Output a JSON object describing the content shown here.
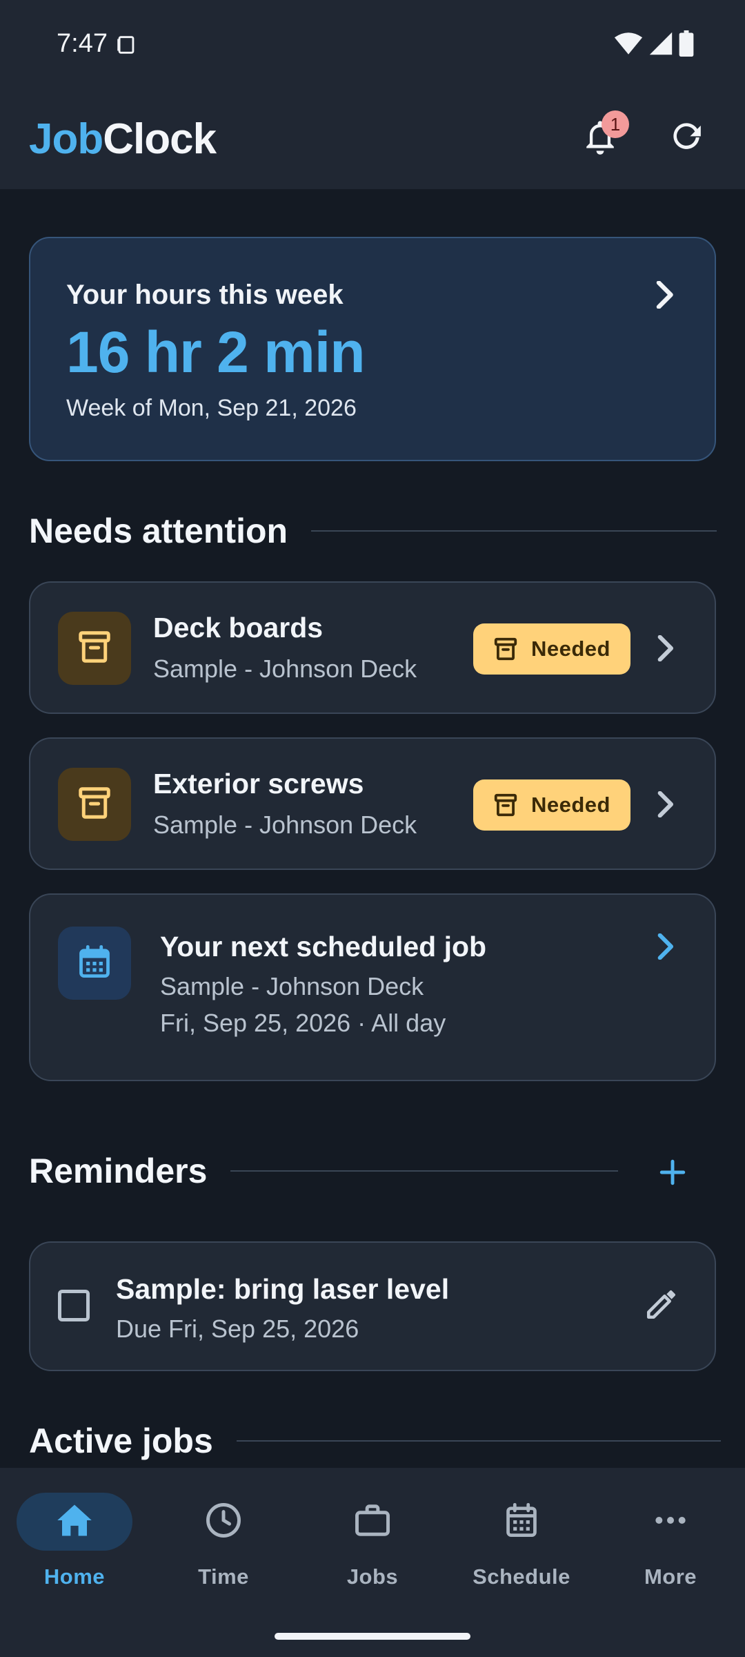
{
  "status_bar": {
    "time": "7:47",
    "icons": [
      "sim-card-icon",
      "wifi-icon",
      "signal-icon",
      "battery-icon"
    ]
  },
  "app_bar": {
    "title_part1": "Job",
    "title_part2": "Clock",
    "notification_count": "1",
    "icons": [
      "bell-icon",
      "refresh-icon"
    ]
  },
  "hours_card": {
    "label": "Your hours this week",
    "value": "16 hr 2 min",
    "week": "Week of Mon, Sep 21, 2026"
  },
  "needs_attention": {
    "title": "Needs attention",
    "items": [
      {
        "title": "Deck boards",
        "subtitle": "Sample - Johnson Deck",
        "status": "Needed",
        "icon": "archive-box-icon"
      },
      {
        "title": "Exterior screws",
        "subtitle": "Sample - Johnson Deck",
        "status": "Needed",
        "icon": "archive-box-icon"
      }
    ],
    "next_job": {
      "title": "Your next scheduled job",
      "subtitle": "Sample - Johnson Deck",
      "date": "Fri, Sep 25, 2026 · All day",
      "icon": "calendar-icon"
    }
  },
  "reminders": {
    "title": "Reminders",
    "add_icon": "plus-icon",
    "items": [
      {
        "title": "Sample: bring laser level",
        "due": "Due Fri, Sep 25, 2026",
        "checked": false
      }
    ]
  },
  "active_jobs": {
    "title": "Active jobs"
  },
  "bottom_nav": {
    "items": [
      {
        "label": "Home",
        "icon": "home-icon",
        "active": true
      },
      {
        "label": "Time",
        "icon": "clock-icon",
        "active": false
      },
      {
        "label": "Jobs",
        "icon": "briefcase-icon",
        "active": false
      },
      {
        "label": "Schedule",
        "icon": "calendar-icon",
        "active": false
      },
      {
        "label": "More",
        "icon": "more-horizontal-icon",
        "active": false
      }
    ]
  },
  "colors": {
    "accent": "#4fb2ee",
    "background": "#141a23",
    "surface": "#212935",
    "needed_chip": "#ffd27a"
  }
}
